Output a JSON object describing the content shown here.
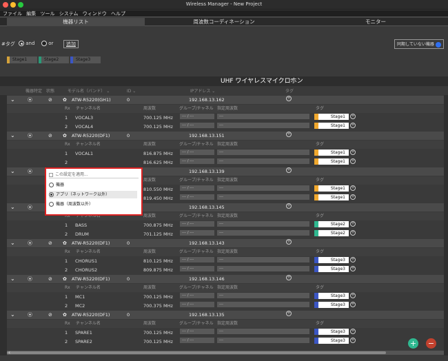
{
  "window": {
    "title": "Wireless Manager - New Project"
  },
  "menu": [
    "ファイル",
    "編集",
    "ツール",
    "システム",
    "ウィンドウ",
    "ヘルプ"
  ],
  "tabs": [
    {
      "label": "機器リスト"
    },
    {
      "label": "周波数コーディネーション"
    },
    {
      "label": "モニター"
    }
  ],
  "tagbar": {
    "label": "#タグ",
    "and": "and",
    "or": "or",
    "add": "追加",
    "unsync": "同期していない機器"
  },
  "tags": [
    {
      "label": "Stage1",
      "color": "#d4a23a"
    },
    {
      "label": "Stage2",
      "color": "#2a9a78"
    },
    {
      "label": "Stage3",
      "color": "#3b56c4"
    }
  ],
  "section": {
    "title": "UHF ワイヤレスマイクロホン"
  },
  "columns": {
    "status1": "機器特定",
    "status2": "状態",
    "model": "モデル名（バンド）",
    "id": "ID",
    "ip": "IPアドレス",
    "tag": "タグ"
  },
  "subheader": {
    "rx": "Rx",
    "channel": "チャンネル名",
    "freq": "周波数",
    "group": "グループ/チャネル",
    "target": "指定周波数",
    "tag": "タグ"
  },
  "devices": [
    {
      "model": "ATW-R5220(GH1)",
      "id": "0",
      "ip": "192.168.13.162",
      "channels": [
        {
          "rx": "1",
          "name": "VOCAL3",
          "freq": "700.125 MHz",
          "tag": "Stage1",
          "tagcolor": "#f0a82e"
        },
        {
          "rx": "2",
          "name": "VOCAL4",
          "freq": "700.125 MHz",
          "tag": "Stage1",
          "tagcolor": "#f0a82e"
        }
      ]
    },
    {
      "model": "ATW-R5220(DF1)",
      "id": "0",
      "ip": "192.168.13.151",
      "channels": [
        {
          "rx": "1",
          "name": "VOCAL1",
          "freq": "816.875 MHz",
          "tag": "Stage1",
          "tagcolor": "#f0a82e"
        },
        {
          "rx": "2",
          "name": "",
          "freq": "816.625 MHz",
          "tag": "Stage1",
          "tagcolor": "#f0a82e"
        }
      ]
    },
    {
      "model": "",
      "id": "",
      "ip": "192.168.13.139",
      "channels": [
        {
          "rx": "",
          "name": "",
          "freq": "810.550 MHz",
          "tag": "Stage1",
          "tagcolor": "#f0a82e"
        },
        {
          "rx": "",
          "name": "",
          "freq": "819.450 MHz",
          "tag": "Stage1",
          "tagcolor": "#f0a82e"
        }
      ]
    },
    {
      "model": "",
      "id": "",
      "ip": "192.168.13.145",
      "channels": [
        {
          "rx": "1",
          "name": "BASS",
          "freq": "700.875 MHz",
          "tag": "Stage2",
          "tagcolor": "#2fb890"
        },
        {
          "rx": "2",
          "name": "DRUM",
          "freq": "701.125 MHz",
          "tag": "Stage2",
          "tagcolor": "#2fb890"
        }
      ]
    },
    {
      "model": "ATW-R5220(DF1)",
      "id": "0",
      "ip": "192.168.13.143",
      "channels": [
        {
          "rx": "1",
          "name": "CHORUS1",
          "freq": "810.125 MHz",
          "tag": "Stage3",
          "tagcolor": "#3b56c4"
        },
        {
          "rx": "2",
          "name": "CHORUS2",
          "freq": "809.875 MHz",
          "tag": "Stage3",
          "tagcolor": "#3b56c4"
        }
      ]
    },
    {
      "model": "ATW-R5220(DF1)",
      "id": "0",
      "ip": "192.168.13.146",
      "channels": [
        {
          "rx": "1",
          "name": "MC1",
          "freq": "700.125 MHz",
          "tag": "Stage3",
          "tagcolor": "#3b56c4"
        },
        {
          "rx": "2",
          "name": "MC2",
          "freq": "700.375 MHz",
          "tag": "Stage3",
          "tagcolor": "#3b56c4"
        }
      ]
    },
    {
      "model": "ATW-R5220(DF1)",
      "id": "0",
      "ip": "192.168.13.135",
      "channels": [
        {
          "rx": "1",
          "name": "SPARE1",
          "freq": "700.125 MHz",
          "tag": "Stage3",
          "tagcolor": "#3b56c4"
        },
        {
          "rx": "2",
          "name": "SPARE2",
          "freq": "700.125 MHz",
          "tag": "Stage3",
          "tagcolor": "#3b56c4"
        }
      ]
    }
  ],
  "popup": {
    "header": "この設定を適用...",
    "items": [
      {
        "label": "機器",
        "selected": false
      },
      {
        "label": "アプリ（ネットワーク以外）",
        "selected": true
      },
      {
        "label": "機器（周波数以外）",
        "selected": false
      }
    ]
  },
  "placeholders": {
    "group": "--- / ---",
    "target": "---"
  },
  "colors": {
    "accent": "#2f6ff0",
    "fab_add": "#2fb890",
    "fab_remove": "#c2412e",
    "popup_border": "#dd2222"
  }
}
